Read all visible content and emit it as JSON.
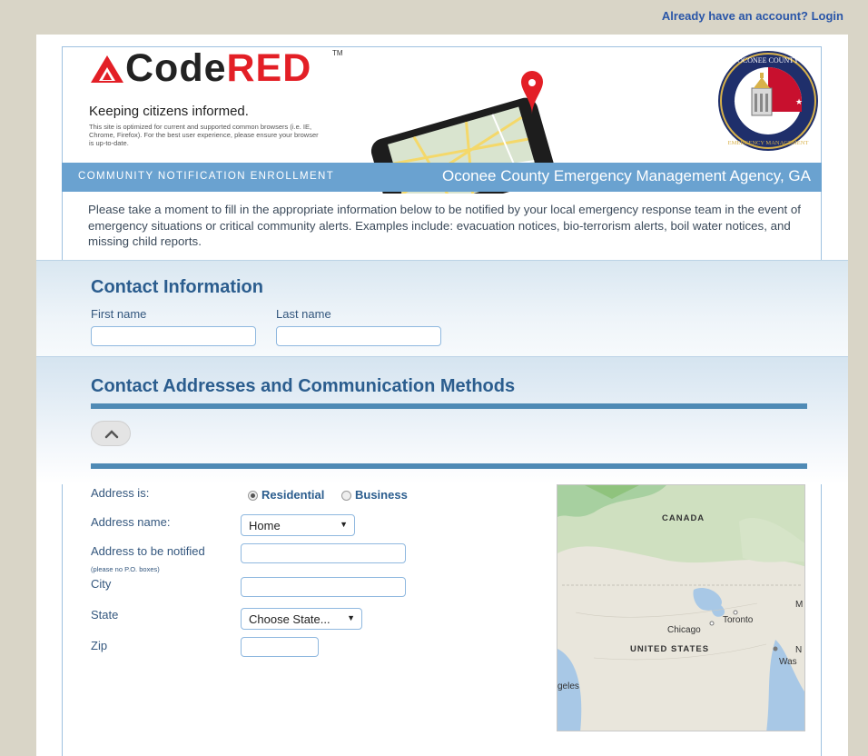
{
  "top_link": "Already have an account? Login",
  "header": {
    "logo_code": "Code",
    "logo_red": "RED",
    "logo_tm": "TM",
    "tagline": "Keeping citizens informed.",
    "browser_note": "This site is optimized for current and supported common browsers (i.e. IE, Chrome, Firefox). For the best user experience, please ensure your browser is up-to-date.",
    "seal_text_top": "OCONEE COUNTY",
    "seal_text_bottom": "EMERGENCY MANAGEMENT"
  },
  "banner": {
    "left": "COMMUNITY NOTIFICATION ENROLLMENT",
    "right": "Oconee County Emergency Management Agency, GA"
  },
  "intro": "Please take a moment to fill in the appropriate information below to be notified by your local emergency response team in the event of emergency situations or critical community alerts. Examples include: evacuation notices, bio-terrorism alerts, boil water notices, and missing child reports.",
  "contact": {
    "heading": "Contact Information",
    "first_name_label": "First name",
    "last_name_label": "Last name",
    "first_name_value": "",
    "last_name_value": ""
  },
  "addresses": {
    "heading": "Contact Addresses and Communication Methods",
    "address_is_label": "Address is:",
    "options": [
      "Residential",
      "Business"
    ],
    "selected_option": "Residential",
    "address_name_label": "Address name:",
    "address_name_value": "Home",
    "address_label": "Address to be notified",
    "address_note": "(please no P.O. boxes)",
    "city_label": "City",
    "state_label": "State",
    "state_value": "Choose State...",
    "zip_label": "Zip"
  },
  "map": {
    "labels": [
      "CANADA",
      "UNITED STATES"
    ],
    "cities": [
      "Toronto",
      "Chicago",
      "geles",
      "Was",
      "N",
      "M"
    ]
  },
  "colors": {
    "accent": "#2b5d8e",
    "banner": "#6aa2d0",
    "brand_red": "#e31f26"
  }
}
